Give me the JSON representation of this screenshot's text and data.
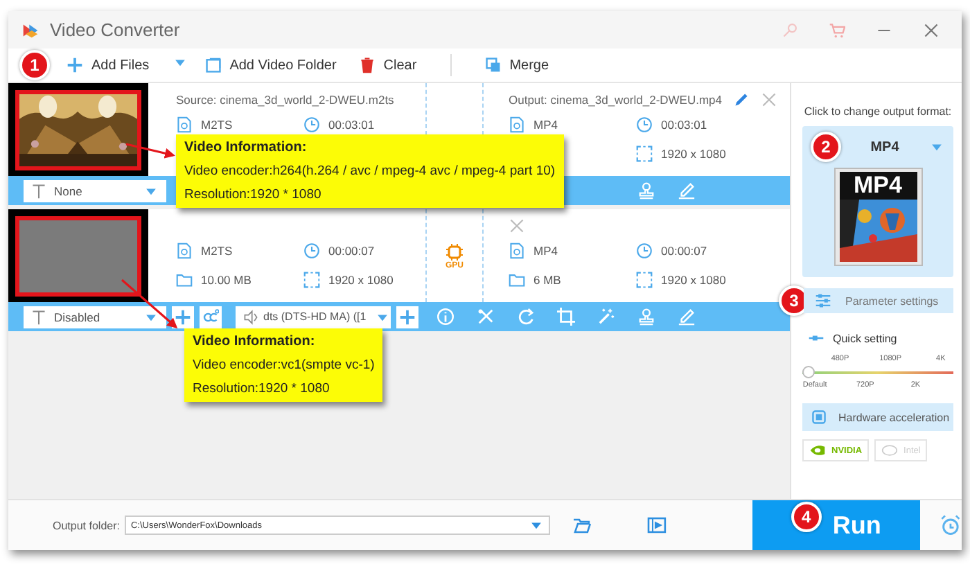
{
  "window": {
    "title": "Video Converter"
  },
  "toolbar": {
    "step": "1",
    "items": [
      {
        "kind": "add_files",
        "label": "Add Files"
      },
      {
        "kind": "add_folder",
        "label": "Add Video Folder"
      },
      {
        "kind": "clear",
        "label": "Clear"
      },
      {
        "kind": "merge",
        "label": "Merge"
      }
    ]
  },
  "files": [
    {
      "thumbnail": {
        "kind": "picture"
      },
      "source": {
        "name": "Source: cinema_3d_world_2-DWEU.m2ts",
        "format": "M2TS",
        "duration": "00:03:01"
      },
      "output": {
        "name": "Output: cinema_3d_world_2-DWEU.mp4",
        "format": "MP4",
        "duration": "00:03:01",
        "resolution": "1920 x 1080"
      },
      "subtitle": "None",
      "tools": [
        {
          "kind": "watermark"
        },
        {
          "kind": "edit"
        }
      ]
    },
    {
      "thumbnail": {
        "kind": "blank"
      },
      "source": {
        "format": "M2TS",
        "duration": "00:00:07",
        "size": "10.00 MB",
        "resolution": "1920 x 1080"
      },
      "gpu": true,
      "gpu_label": "GPU",
      "output": {
        "format": "MP4",
        "duration": "00:00:07",
        "size": "6 MB",
        "resolution": "1920 x 1080"
      },
      "subtitle": "Disabled",
      "audio": "dts (DTS-HD MA) ([1",
      "tools": [
        {
          "kind": "info"
        },
        {
          "kind": "cut"
        },
        {
          "kind": "rotate"
        },
        {
          "kind": "crop"
        },
        {
          "kind": "effects"
        },
        {
          "kind": "watermark"
        },
        {
          "kind": "edit"
        }
      ]
    }
  ],
  "tooltips": [
    {
      "title": "Video Information:",
      "lines": [
        "Video encoder:h264(h.264 / avc / mpeg-4 avc / mpeg-4 part 10)",
        "Resolution:1920 * 1080"
      ]
    },
    {
      "title": "Video Information:",
      "lines": [
        "Video encoder:vc1(smpte vc-1)",
        "Resolution:1920 * 1080"
      ]
    }
  ],
  "format_panel": {
    "hint": "Click to change output format:",
    "step": "2",
    "format": "MP4",
    "icon_label": "MP4"
  },
  "parameter_settings": {
    "step": "3",
    "label": "Parameter settings"
  },
  "quick_setting": {
    "label": "Quick setting",
    "top_labels": [
      "480P",
      "1080P",
      "4K"
    ],
    "bottom_labels": [
      "Default",
      "720P",
      "2K"
    ],
    "level": 0
  },
  "hardware": {
    "label": "Hardware acceleration",
    "options": [
      {
        "label": "NVIDIA",
        "disabled": false
      },
      {
        "label": "Intel",
        "disabled": true
      }
    ]
  },
  "output_folder": {
    "label": "Output folder:",
    "value": "C:\\Users\\WonderFox\\Downloads"
  },
  "run": {
    "step": "4",
    "label": "Run"
  }
}
